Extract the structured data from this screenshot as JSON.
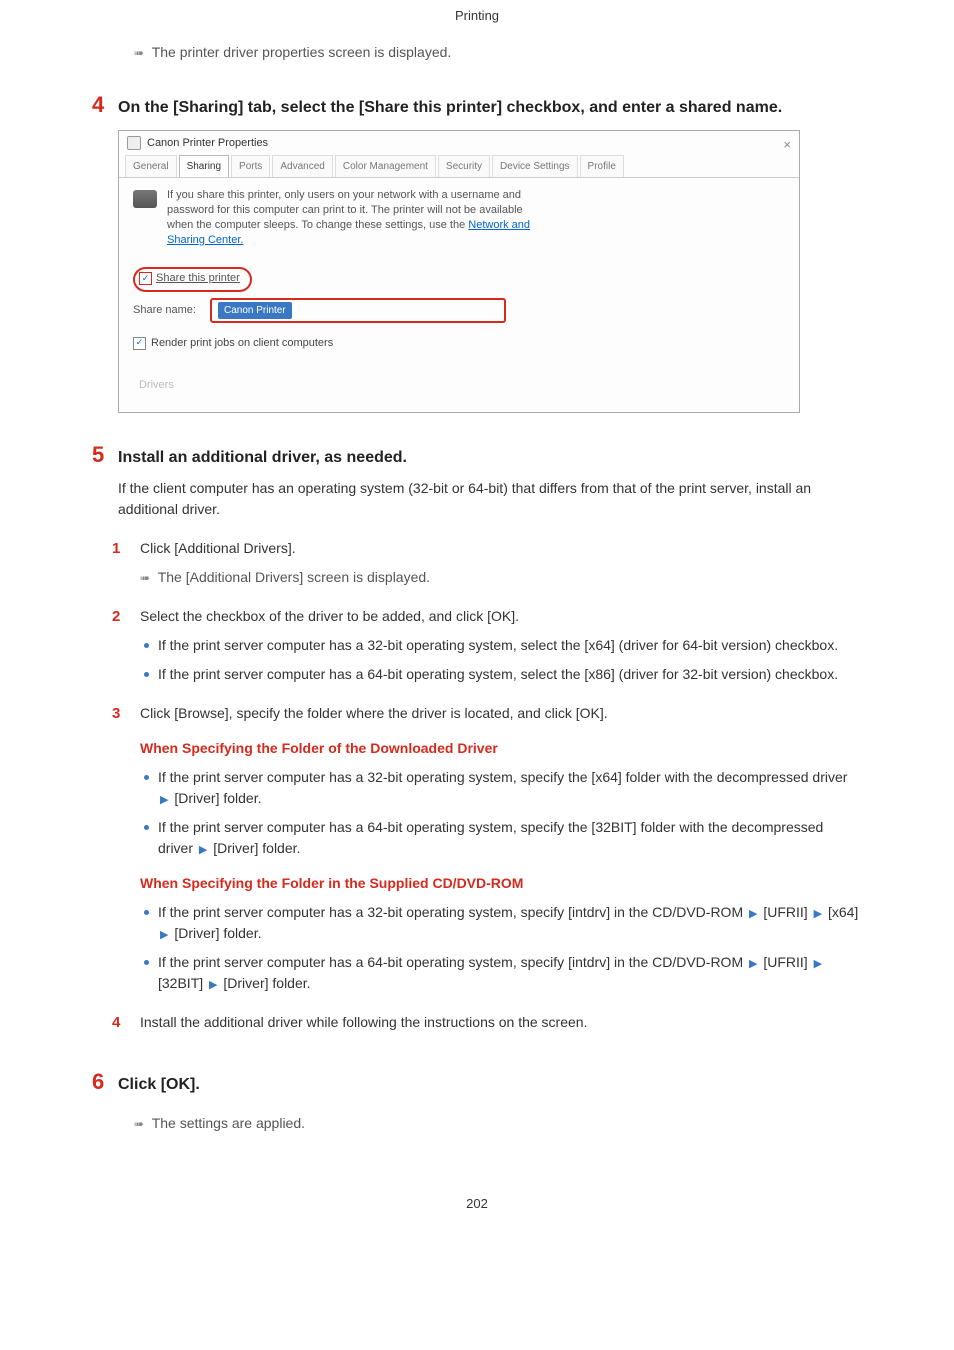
{
  "header": "Printing",
  "result1": "The printer driver properties screen is displayed.",
  "step4": {
    "num": "4",
    "title": "On the [Sharing] tab, select the [Share this printer] checkbox, and enter a shared name."
  },
  "screenshot": {
    "title": "Canon Printer Properties",
    "tabs": [
      "General",
      "Sharing",
      "Ports",
      "Advanced",
      "Color Management",
      "Security",
      "Device Settings",
      "Profile"
    ],
    "info1": "If you share this printer, only users on your network with a username and password for this computer can print to it. The printer will not be available when the computer sleeps. To change these settings, use the ",
    "info_link": "Network and Sharing Center.",
    "share_chk": "Share this printer",
    "share_name_label": "Share name:",
    "share_name_value": "Canon Printer",
    "render": "Render print jobs on client computers",
    "drivers": "Drivers"
  },
  "step5": {
    "num": "5",
    "title": "Install an additional driver, as needed.",
    "explain": "If the client computer has an operating system (32-bit or 64-bit) that differs from that of the print server, install an additional driver."
  },
  "sub1": {
    "num": "1",
    "text": "Click [Additional Drivers].",
    "result": "The [Additional Drivers] screen is displayed."
  },
  "sub2": {
    "num": "2",
    "text": "Select the checkbox of the driver to be added, and click [OK].",
    "b1": "If the print server computer has a 32-bit operating system, select the [x64] (driver for 64-bit version) checkbox.",
    "b2": "If the print server computer has a 64-bit operating system, select the [x86] (driver for 32-bit version) checkbox."
  },
  "sub3": {
    "num": "3",
    "text": "Click [Browse], specify the folder where the driver is located, and click [OK].",
    "head1": "When Specifying the Folder of the Downloaded Driver",
    "h1b1a": "If the print server computer has a 32-bit operating system, specify the [x64] folder with the decompressed driver ",
    "h1b1b": " [Driver] folder.",
    "h1b2a": "If the print server computer has a 64-bit operating system, specify the [32BIT] folder with the decompressed driver ",
    "h1b2b": " [Driver] folder.",
    "head2": "When Specifying the Folder in the Supplied CD/DVD-ROM",
    "h2b1a": "If the print server computer has a 32-bit operating system, specify [intdrv] in the CD/DVD-ROM ",
    "h2b1b": " [UFRII] ",
    "h2b1c": " [x64] ",
    "h2b1d": " [Driver] folder.",
    "h2b2a": "If the print server computer has a 64-bit operating system, specify [intdrv] in the CD/DVD-ROM ",
    "h2b2b": " [UFRII] ",
    "h2b2c": " [32BIT] ",
    "h2b2d": " [Driver] folder."
  },
  "sub4": {
    "num": "4",
    "text": "Install the additional driver while following the instructions on the screen."
  },
  "step6": {
    "num": "6",
    "title": "Click [OK].",
    "result": "The settings are applied."
  },
  "page_num": "202"
}
